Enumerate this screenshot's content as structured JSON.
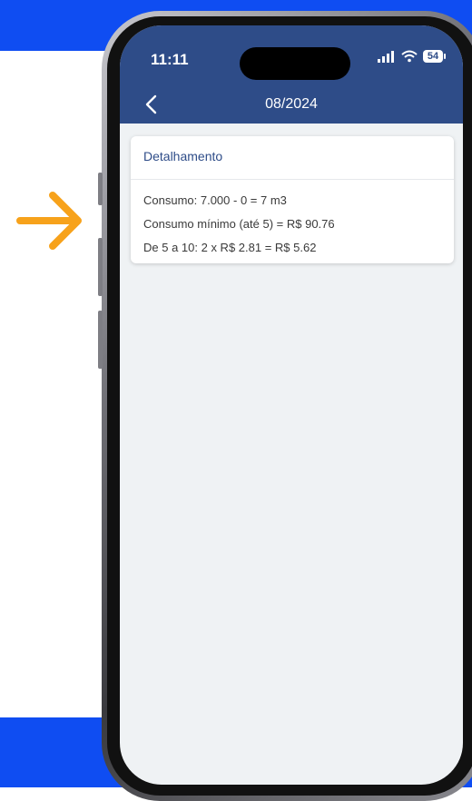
{
  "status_bar": {
    "time": "11:11",
    "battery": "54"
  },
  "header": {
    "title": "08/2024",
    "back_icon": "chevron-left-icon"
  },
  "card": {
    "title": "Detalhamento",
    "lines": [
      "Consumo: 7.000 - 0 = 7 m3",
      "Consumo mínimo (até 5) = R$ 90.76",
      "De 5 a 10: 2 x R$ 2.81 = R$ 5.62"
    ]
  },
  "colors": {
    "background_blue": "#0f4df2",
    "header_blue": "#2e4c88",
    "arrow_orange": "#f7a21b",
    "screen_bg": "#eff2f4"
  }
}
